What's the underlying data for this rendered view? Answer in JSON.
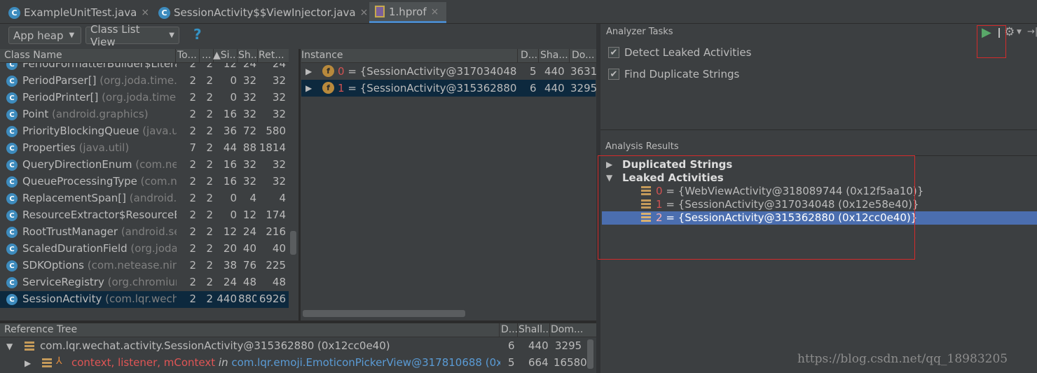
{
  "tabs": [
    {
      "label": "ExampleUnitTest.java",
      "close": "×"
    },
    {
      "label": "SessionActivity$$ViewInjector.java",
      "close": "×"
    },
    {
      "label": "1.hprof",
      "close": "×"
    }
  ],
  "toolbar": {
    "heap": "App heap",
    "view": "Class List View",
    "help": "?"
  },
  "class_table": {
    "headers": [
      "Class Name",
      "To...",
      "...",
      "▲Si...",
      "Sh...",
      "Ret..."
    ],
    "rows": [
      {
        "name": "PeriodFormatterBuilder$Litera",
        "pkg": "",
        "c1": "2",
        "c2": "2",
        "c3": "12",
        "c4": "24",
        "c5": "24"
      },
      {
        "name": "PeriodParser[]",
        "pkg": " (org.joda.time.f",
        "c1": "2",
        "c2": "2",
        "c3": "0",
        "c4": "32",
        "c5": "32"
      },
      {
        "name": "PeriodPrinter[]",
        "pkg": " (org.joda.time.",
        "c1": "2",
        "c2": "2",
        "c3": "0",
        "c4": "32",
        "c5": "32"
      },
      {
        "name": "Point",
        "pkg": " (android.graphics)",
        "c1": "2",
        "c2": "2",
        "c3": "16",
        "c4": "32",
        "c5": "32"
      },
      {
        "name": "PriorityBlockingQueue",
        "pkg": " (java.ut",
        "c1": "2",
        "c2": "2",
        "c3": "36",
        "c4": "72",
        "c5": "580"
      },
      {
        "name": "Properties",
        "pkg": " (java.util)",
        "c1": "7",
        "c2": "2",
        "c3": "44",
        "c4": "88",
        "c5": "1814"
      },
      {
        "name": "QueryDirectionEnum",
        "pkg": " (com.net",
        "c1": "2",
        "c2": "2",
        "c3": "16",
        "c4": "32",
        "c5": "32"
      },
      {
        "name": "QueueProcessingType",
        "pkg": " (com.nc",
        "c1": "2",
        "c2": "2",
        "c3": "16",
        "c4": "32",
        "c5": "32"
      },
      {
        "name": "ReplacementSpan[]",
        "pkg": " (android.te",
        "c1": "2",
        "c2": "2",
        "c3": "0",
        "c4": "4",
        "c5": "4"
      },
      {
        "name": "ResourceExtractor$ResourceE",
        "pkg": "",
        "c1": "2",
        "c2": "2",
        "c3": "0",
        "c4": "12",
        "c5": "174"
      },
      {
        "name": "RootTrustManager",
        "pkg": " (android.se",
        "c1": "2",
        "c2": "2",
        "c3": "12",
        "c4": "24",
        "c5": "216"
      },
      {
        "name": "ScaledDurationField",
        "pkg": " (org.joda.",
        "c1": "2",
        "c2": "2",
        "c3": "20",
        "c4": "40",
        "c5": "40"
      },
      {
        "name": "SDKOptions",
        "pkg": " (com.netease.nim",
        "c1": "2",
        "c2": "2",
        "c3": "38",
        "c4": "76",
        "c5": "225"
      },
      {
        "name": "ServiceRegistry",
        "pkg": " (org.chromiun",
        "c1": "2",
        "c2": "2",
        "c3": "24",
        "c4": "48",
        "c5": "48"
      },
      {
        "name": "SessionActivity",
        "pkg": " (com.lqr.wecha",
        "c1": "2",
        "c2": "2",
        "c3": "440",
        "c4": "880",
        "c5": "6926"
      }
    ]
  },
  "instance_table": {
    "headers": [
      "Instance",
      "D...",
      "Sha...",
      "Do..."
    ],
    "rows": [
      {
        "index": "0",
        "value": " = {SessionActivity@317034048 (0",
        "d": "5",
        "sha": "440",
        "do": "3631"
      },
      {
        "index": "1",
        "value": " = {SessionActivity@315362880 (0",
        "d": "6",
        "sha": "440",
        "do": "3295"
      }
    ]
  },
  "reference_tree": {
    "headers": [
      "Reference Tree",
      "D...",
      "Shall...",
      "Dom..."
    ],
    "rows": [
      {
        "text": "com.lqr.wechat.activity.SessionActivity@315362880 (0x12cc0e40)",
        "d": "6",
        "shall": "440",
        "dom": "3295"
      },
      {
        "fields": "context, listener, mContext",
        "in": " in ",
        "ref": "com.lqr.emoji.EmoticonPickerView@317810688 (0x12",
        "d": "5",
        "shall": "664",
        "dom": "16580"
      }
    ]
  },
  "analyzer": {
    "title": "Analyzer Tasks",
    "tasks": [
      "Detect Leaked Activities",
      "Find Duplicate Strings"
    ]
  },
  "results": {
    "title": "Analysis Results",
    "groups": [
      "Duplicated Strings",
      "Leaked Activities"
    ],
    "items": [
      {
        "index": "0",
        "value": " = {WebViewActivity@318089744 (0x12f5aa10)}"
      },
      {
        "index": "1",
        "value": " = {SessionActivity@317034048 (0x12e58e40)}"
      },
      {
        "index": "2",
        "value": " = {SessionActivity@315362880 (0x12cc0e40)}"
      }
    ]
  },
  "watermark": "https://blog.csdn.net/qq_18983205",
  "colors": {
    "accent": "#4b6eaf",
    "highlight_box": "#d42b2b",
    "run": "#59a869"
  }
}
